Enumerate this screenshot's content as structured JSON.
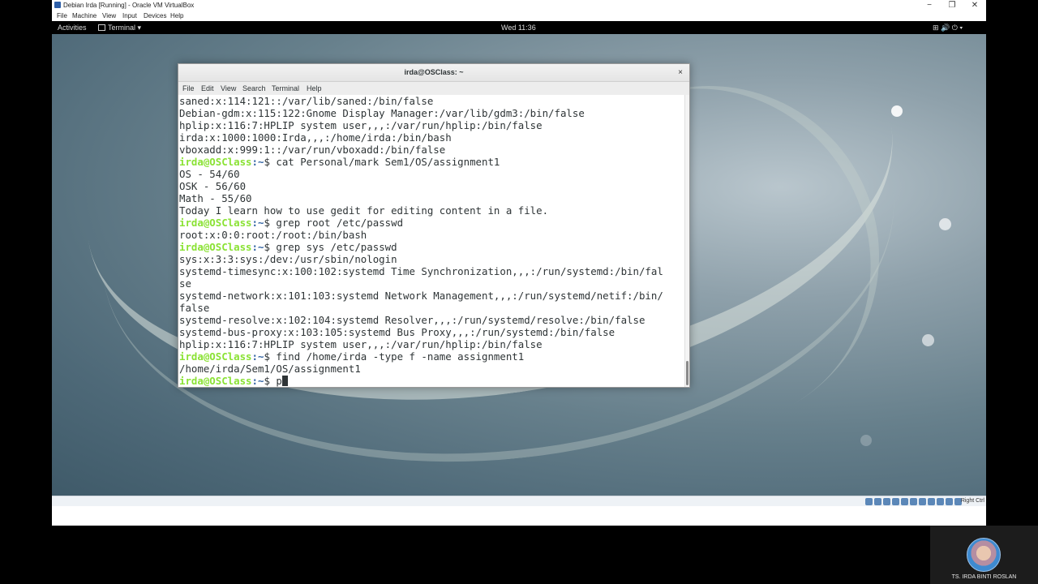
{
  "vbox": {
    "title": "Debian Irda [Running] - Oracle VM VirtualBox",
    "menu": [
      "File",
      "Machine",
      "View",
      "Input",
      "Devices",
      "Help"
    ],
    "minimize": "−",
    "maximize": "❐",
    "close": "✕",
    "host_key": "Right Ctrl"
  },
  "gnome": {
    "activities": "Activities",
    "app_menu": "Terminal ▾",
    "clock": "Wed 11:36",
    "tray": "⊞  🔊  ⏻ ▾"
  },
  "terminal": {
    "title": "irda@OSClass: ~",
    "close": "×",
    "menu": [
      "File",
      "Edit",
      "View",
      "Search",
      "Terminal",
      "Help"
    ],
    "prompt_user": "irda@OSClass",
    "prompt_path": ":~",
    "lines": [
      {
        "type": "out",
        "text": "saned:x:114:121::/var/lib/saned:/bin/false"
      },
      {
        "type": "out",
        "text": "Debian-gdm:x:115:122:Gnome Display Manager:/var/lib/gdm3:/bin/false"
      },
      {
        "type": "out",
        "text": "hplip:x:116:7:HPLIP system user,,,:/var/run/hplip:/bin/false"
      },
      {
        "type": "out",
        "text": "irda:x:1000:1000:Irda,,,:/home/irda:/bin/bash"
      },
      {
        "type": "out",
        "text": "vboxadd:x:999:1::/var/run/vboxadd:/bin/false"
      },
      {
        "type": "cmd",
        "text": "$ cat Personal/mark Sem1/OS/assignment1"
      },
      {
        "type": "out",
        "text": "OS - 54/60"
      },
      {
        "type": "out",
        "text": "OSK - 56/60"
      },
      {
        "type": "out",
        "text": "Math - 55/60"
      },
      {
        "type": "out",
        "text": "Today I learn how to use gedit for editing content in a file."
      },
      {
        "type": "cmd",
        "text": "$ grep root /etc/passwd"
      },
      {
        "type": "out",
        "text": "root:x:0:0:root:/root:/bin/bash"
      },
      {
        "type": "cmd",
        "text": "$ grep sys /etc/passwd"
      },
      {
        "type": "out",
        "text": "sys:x:3:3:sys:/dev:/usr/sbin/nologin"
      },
      {
        "type": "out",
        "text": "systemd-timesync:x:100:102:systemd Time Synchronization,,,:/run/systemd:/bin/fal"
      },
      {
        "type": "out",
        "text": "se"
      },
      {
        "type": "out",
        "text": "systemd-network:x:101:103:systemd Network Management,,,:/run/systemd/netif:/bin/"
      },
      {
        "type": "out",
        "text": "false"
      },
      {
        "type": "out",
        "text": "systemd-resolve:x:102:104:systemd Resolver,,,:/run/systemd/resolve:/bin/false"
      },
      {
        "type": "out",
        "text": "systemd-bus-proxy:x:103:105:systemd Bus Proxy,,,:/run/systemd:/bin/false"
      },
      {
        "type": "out",
        "text": "hplip:x:116:7:HPLIP system user,,,:/var/run/hplip:/bin/false"
      },
      {
        "type": "cmd",
        "text": "$ find /home/irda -type f -name assignment1"
      },
      {
        "type": "out",
        "text": "/home/irda/Sem1/OS/assignment1"
      },
      {
        "type": "cmd",
        "text": "$ p",
        "cursor": true
      }
    ]
  },
  "webcam": {
    "name": "TS. IRDA BINTI ROSLAN"
  }
}
